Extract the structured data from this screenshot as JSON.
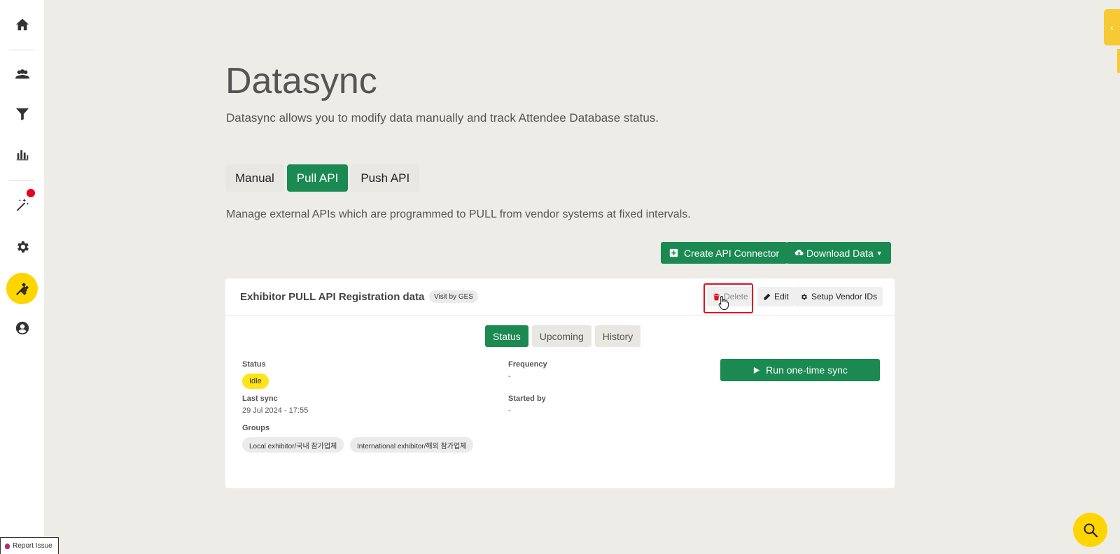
{
  "sidebar": {
    "items": [
      {
        "name": "home-icon"
      },
      {
        "name": "people-icon"
      },
      {
        "name": "filter-icon"
      },
      {
        "name": "bar-chart-icon"
      },
      {
        "name": "magic-wand-icon"
      },
      {
        "name": "gear-icon"
      },
      {
        "name": "tools-icon"
      },
      {
        "name": "user-circle-icon"
      }
    ]
  },
  "page": {
    "title": "Datasync",
    "subtitle": "Datasync allows you to modify data manually and track Attendee Database status."
  },
  "tabs": [
    {
      "label": "Manual",
      "active": false
    },
    {
      "label": "Pull API",
      "active": true
    },
    {
      "label": "Push API",
      "active": false
    }
  ],
  "description": "Manage external APIs which are programmed to PULL from vendor systems at fixed intervals.",
  "actions": {
    "create_label": "Create API Connector",
    "download_label": "Download Data"
  },
  "connector": {
    "title": "Exhibitor PULL API Registration data",
    "badge": "Visit by GES",
    "delete_label": "Delete",
    "edit_label": "Edit",
    "vendor_label": "Setup Vendor IDs",
    "subtabs": [
      {
        "label": "Status",
        "active": true
      },
      {
        "label": "Upcoming",
        "active": false
      },
      {
        "label": "History",
        "active": false
      }
    ],
    "status_label": "Status",
    "status_value": "Idle",
    "last_sync_label": "Last sync",
    "last_sync_value": "29 Jul 2024 - 17:55",
    "groups_label": "Groups",
    "groups": [
      "Local exhibitor/국내 참가업체",
      "International exhibitor/해외 참가업체"
    ],
    "frequency_label": "Frequency",
    "frequency_value": "-",
    "started_by_label": "Started by",
    "started_by_value": "-",
    "run_label": "Run one-time sync"
  },
  "report_issue": "Report Issue",
  "colors": {
    "accent_green": "#1a8a52",
    "highlight_yellow": "#ffd500",
    "alert_red": "#e3101d"
  }
}
